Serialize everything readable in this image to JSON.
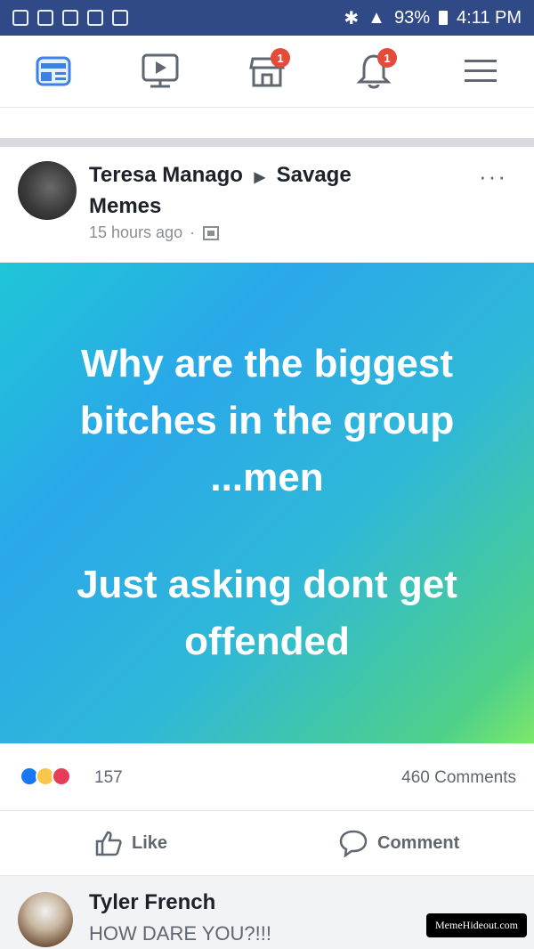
{
  "status_bar": {
    "battery": "93%",
    "time": "4:11 PM"
  },
  "nav": {
    "marketplace_badge": "1",
    "notifications_badge": "1"
  },
  "post": {
    "author": "Teresa Manago",
    "group": "Savage Memes",
    "time": "15 hours ago",
    "text_line1": "Why are the biggest bitches in the group ...men",
    "text_line2": "Just asking dont get offended",
    "reaction_count": "157",
    "comments_count": "460 Comments",
    "like_label": "Like",
    "comment_label": "Comment",
    "accent": "#1877f2"
  },
  "comment": {
    "name": "Tyler French",
    "text": "HOW DARE YOU?!!!"
  },
  "watermark": "MemeHideout.com"
}
